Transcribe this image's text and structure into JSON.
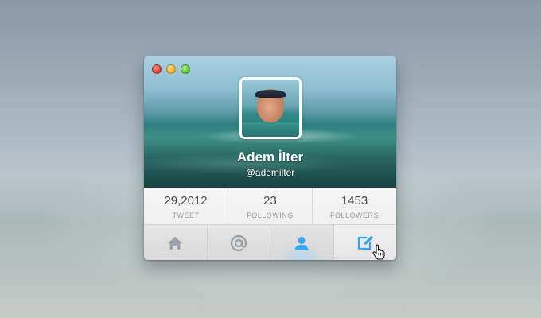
{
  "window": {
    "controls": [
      "close",
      "minimize",
      "zoom"
    ]
  },
  "profile": {
    "name": "Adem İlter",
    "handle": "@ademilter"
  },
  "stats": [
    {
      "value": "29,2012",
      "label": "TWEET"
    },
    {
      "value": "23",
      "label": "FOLLOWING"
    },
    {
      "value": "1453",
      "label": "FOLLOWERS"
    }
  ],
  "tabs": [
    {
      "icon": "home-icon",
      "active": false
    },
    {
      "icon": "mention-icon",
      "active": false
    },
    {
      "icon": "profile-icon",
      "active": true
    },
    {
      "icon": "compose-icon",
      "active": false
    }
  ],
  "colors": {
    "icon_gray": "#9aa3ab",
    "icon_blue": "#3aa6e6",
    "text_dark": "#4a4a4a",
    "text_label": "#9a9a9a"
  }
}
